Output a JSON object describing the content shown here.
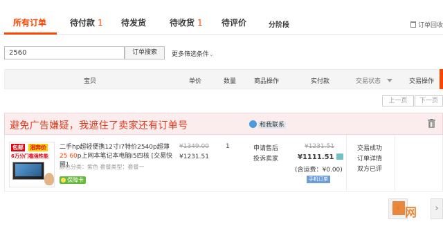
{
  "tabs": [
    {
      "label": "所有订单",
      "count": ""
    },
    {
      "label": "待付款",
      "count": "1"
    },
    {
      "label": "待发货",
      "count": ""
    },
    {
      "label": "待收货",
      "count": "1"
    },
    {
      "label": "待评价",
      "count": ""
    },
    {
      "label": "分阶段",
      "count": ""
    }
  ],
  "trash_label": "订单回收",
  "search": {
    "value": "2560",
    "button": "订单搜索",
    "more_filters": "更多筛选条件"
  },
  "table_headers": {
    "item": "宝贝",
    "price": "单价",
    "qty": "数量",
    "item_ops": "商品操作",
    "paid": "实付款",
    "status": "交易状态",
    "ops": "交易操作"
  },
  "pagination": {
    "prev": "上一页",
    "next": "下一页"
  },
  "order": {
    "notice": "避免广告嫌疑，我遮住了卖家还有订单号",
    "contact_label": "和我联系",
    "thumb": {
      "badge1": "包邮",
      "badge2": "泪奔价",
      "line": "6万分门槛强性能"
    },
    "title_prefix": "二手hp超轻便携12寸i7特价2540p超薄",
    "title_hl": "25\n60",
    "title_suffix": "p上网本笔记本电脑i5四核 [交易快照]",
    "meta": "颜色分类：紫色  套餐类型：套餐一",
    "guarantee": "保障卡",
    "price_orig": "¥1349.00",
    "price_now": "¥1231.51",
    "qty": "1",
    "op_after_sale": "申请售后",
    "op_complain": "投诉卖家",
    "paid_orig": "¥1231.51",
    "paid_now": "¥1111.51",
    "shipping": "(含运费：¥0.00)",
    "phone_order": "手机订单",
    "status_done": "交易成功",
    "status_detail": "订单详情",
    "status_sign": "双方已评"
  },
  "colors": {
    "accent": "#ff4400",
    "notice_bg": "#fbecee",
    "notice_text": "#e03a1b"
  }
}
